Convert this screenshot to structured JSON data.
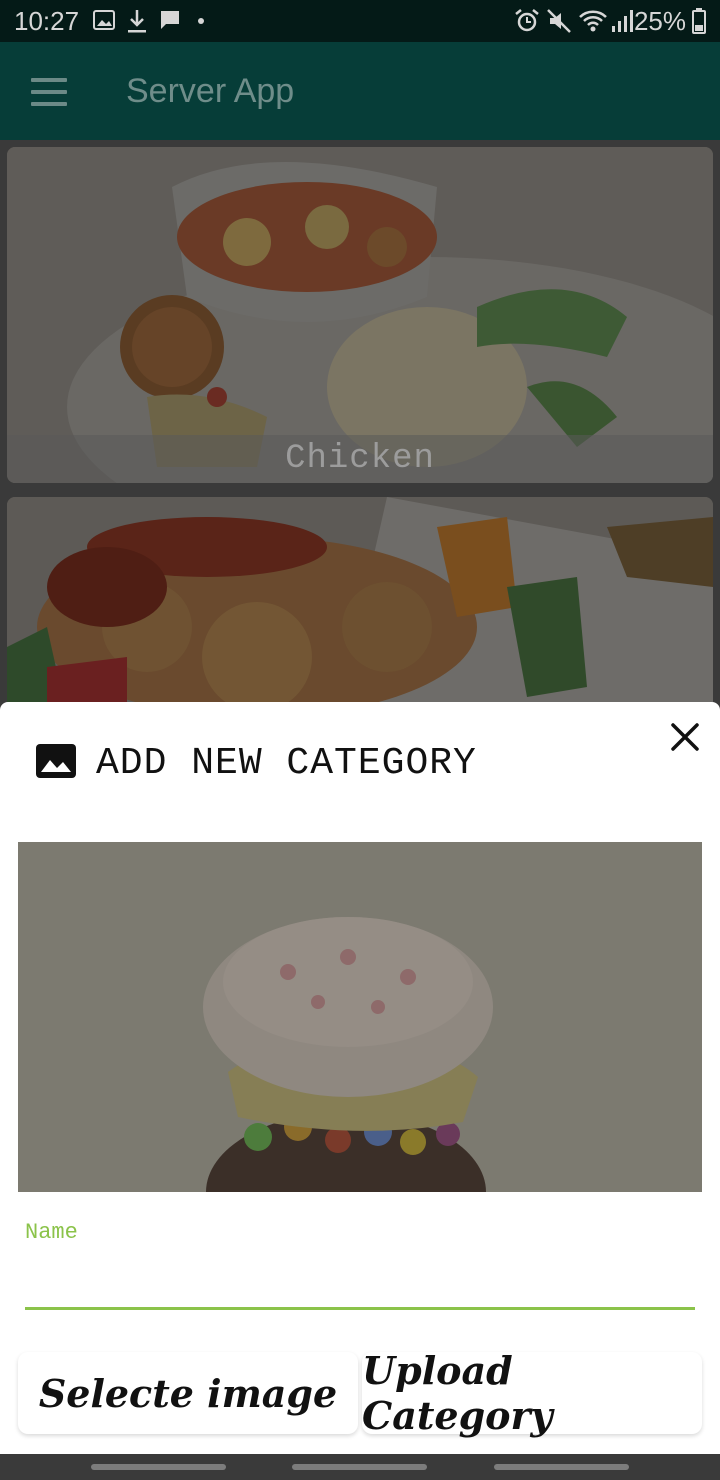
{
  "status_bar": {
    "time": "10:27",
    "battery": "25%",
    "left_icons": [
      "image-icon",
      "download-icon",
      "message-icon",
      "dot-icon"
    ],
    "right_icons": [
      "alarm-icon",
      "mute-icon",
      "wifi-icon",
      "signal-icon",
      "battery-icon"
    ]
  },
  "toolbar": {
    "menu_icon": "hamburger-icon",
    "title": "Server App",
    "background": "#063d38"
  },
  "list": {
    "items": [
      {
        "label": "Chicken"
      },
      {
        "label": ""
      }
    ]
  },
  "dialog": {
    "icon": "image-icon",
    "title": "ADD NEW CATEGORY",
    "close_icon": "close-icon",
    "name_label": "Name",
    "name_value": "",
    "select_button": "Selecte image",
    "upload_button": "Upload Category",
    "accent": "#8bc34a"
  }
}
